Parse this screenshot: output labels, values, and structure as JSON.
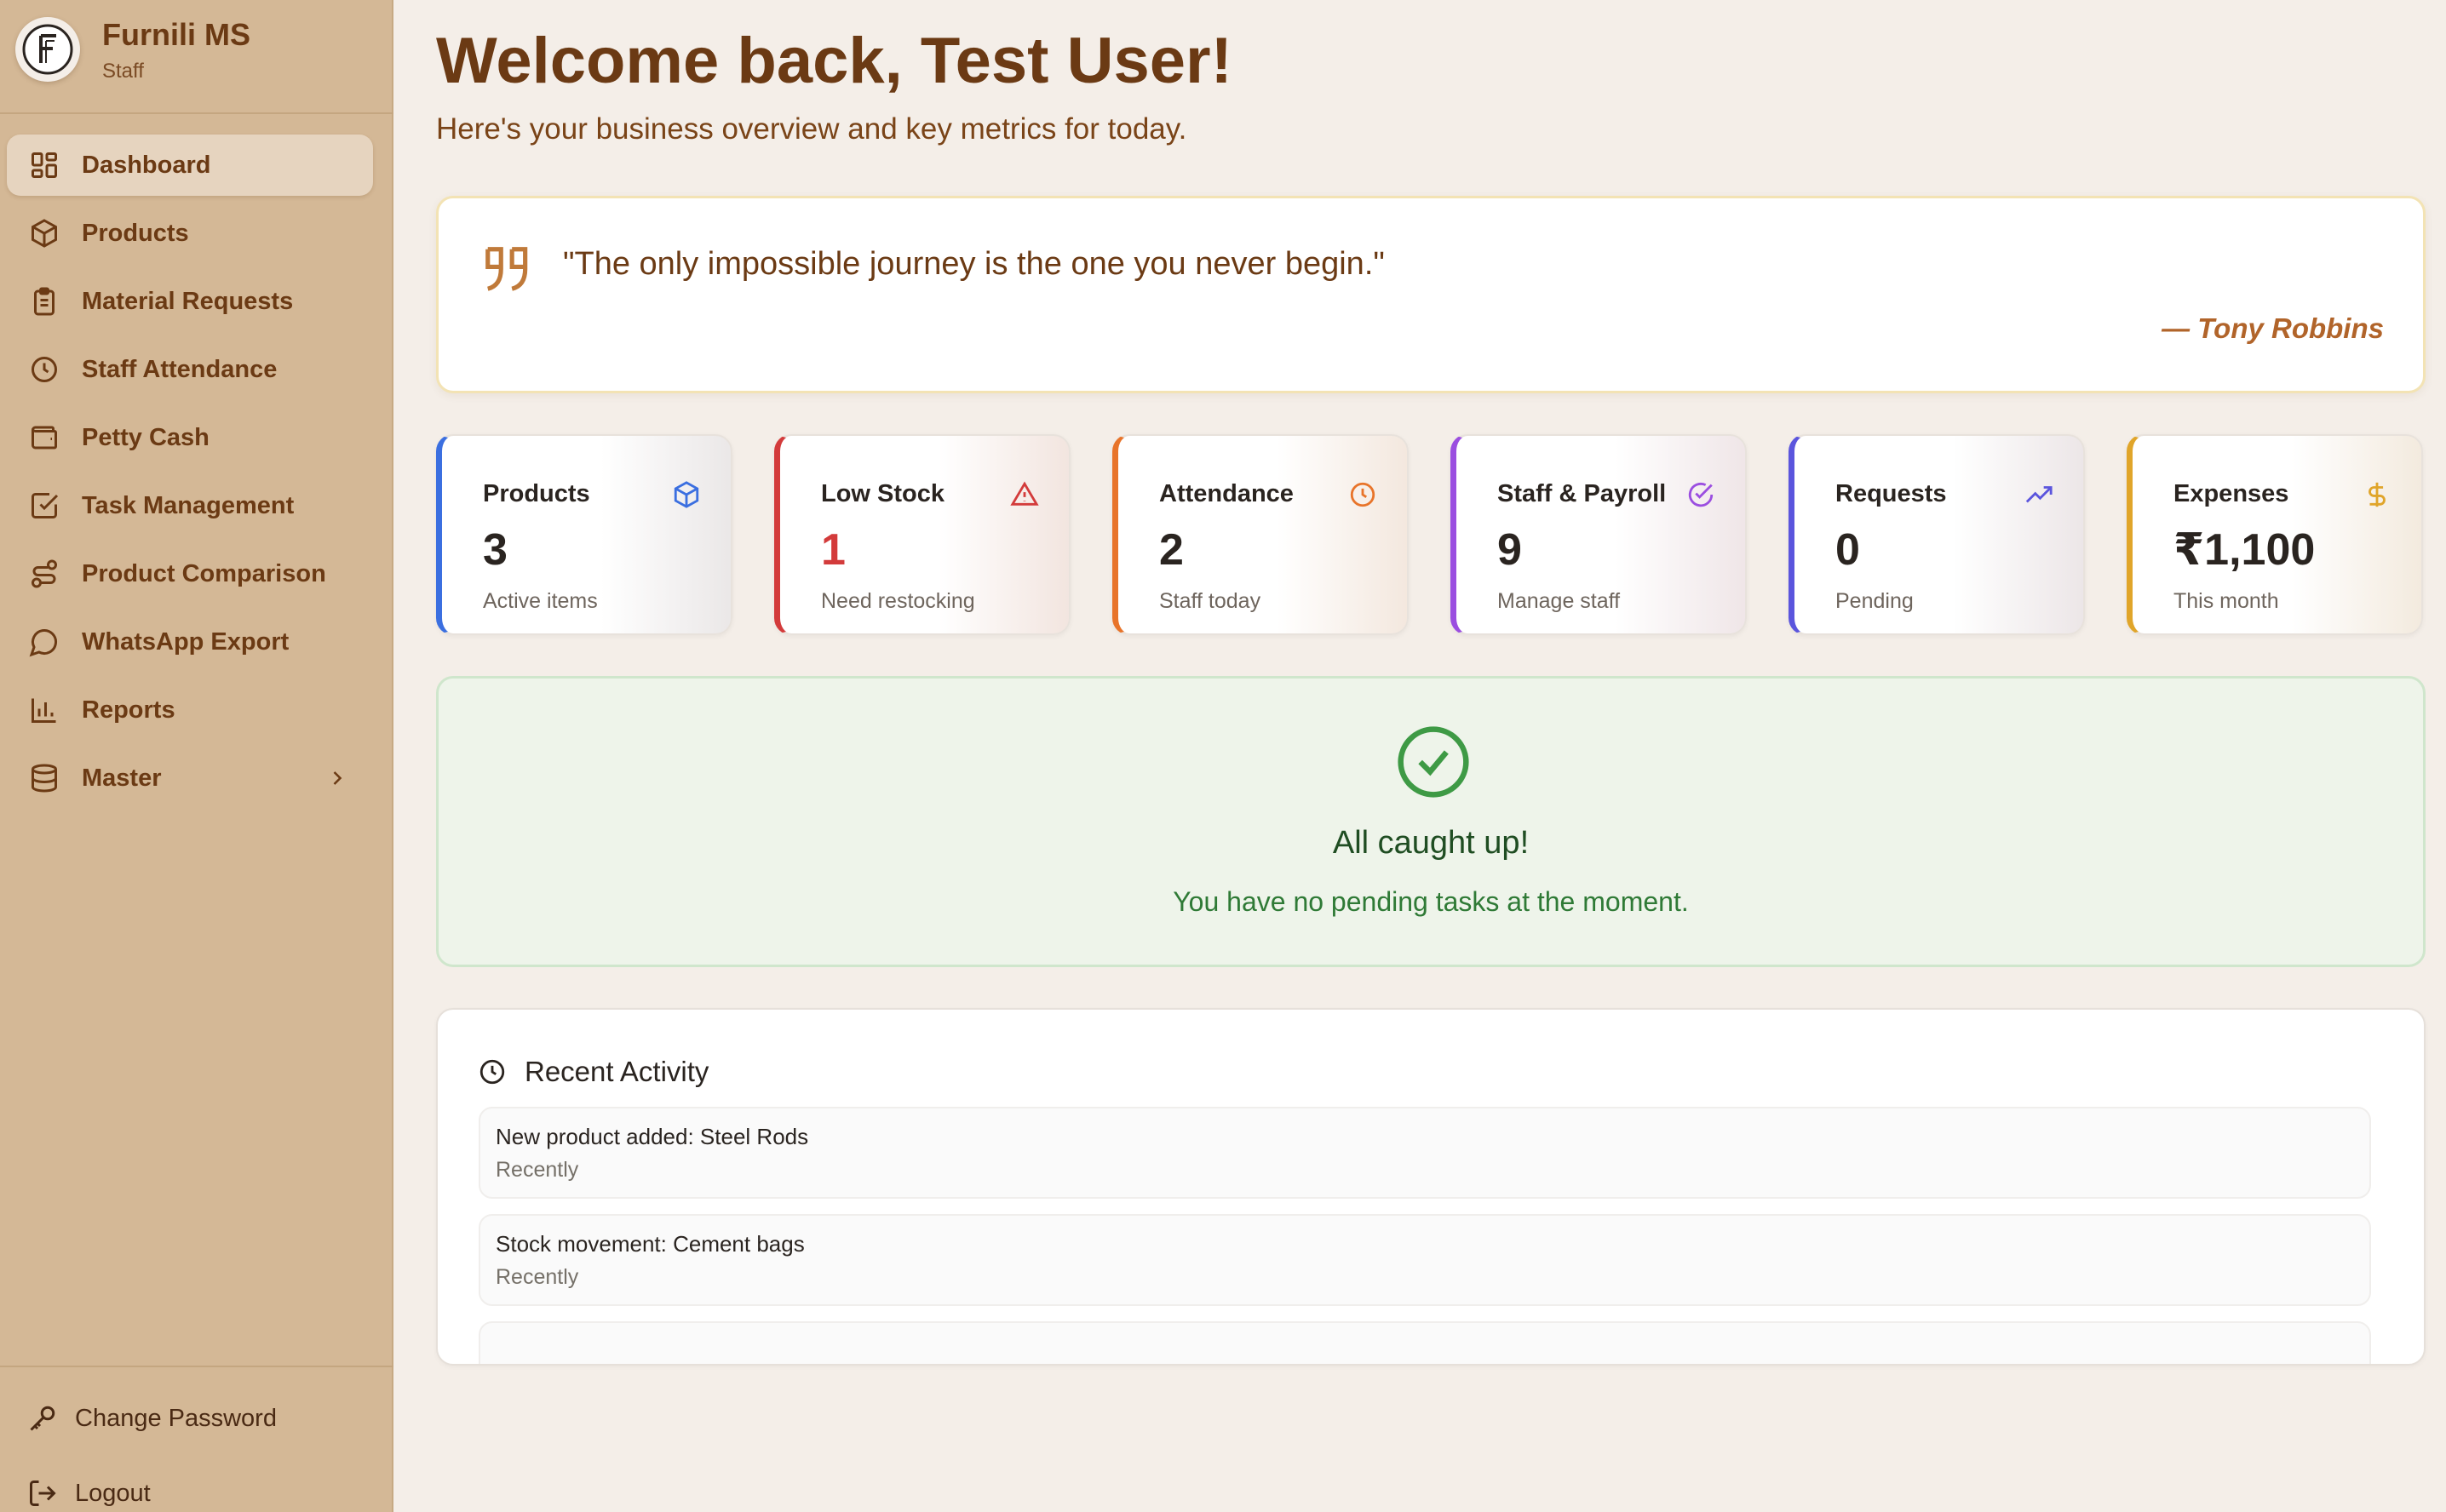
{
  "app": {
    "name": "Furnili MS",
    "role": "Staff",
    "logo_letter": "F"
  },
  "sidebar": {
    "items": [
      {
        "label": "Dashboard",
        "icon": "grid-icon",
        "active": true
      },
      {
        "label": "Products",
        "icon": "box-icon"
      },
      {
        "label": "Material Requests",
        "icon": "clipboard-icon"
      },
      {
        "label": "Staff Attendance",
        "icon": "clock-icon"
      },
      {
        "label": "Petty Cash",
        "icon": "wallet-icon"
      },
      {
        "label": "Task Management",
        "icon": "check-square-icon"
      },
      {
        "label": "Product Comparison",
        "icon": "route-icon"
      },
      {
        "label": "WhatsApp Export",
        "icon": "chat-bubble-icon"
      },
      {
        "label": "Reports",
        "icon": "bar-chart-icon"
      },
      {
        "label": "Master",
        "icon": "database-icon",
        "has_submenu": true
      }
    ],
    "bottom": {
      "change_password": "Change Password",
      "logout": "Logout"
    }
  },
  "header": {
    "welcome": "Welcome back, Test User!",
    "subtitle": "Here's your business overview and key metrics for today."
  },
  "quote": {
    "text": "\"The only impossible journey is the one you never begin.\"",
    "author": "— Tony Robbins"
  },
  "stats": [
    {
      "title": "Products",
      "value": "3",
      "label": "Active items",
      "accent": "#3b6fe0",
      "icon": "box-icon"
    },
    {
      "title": "Low Stock",
      "value": "1",
      "label": "Need restocking",
      "accent": "#d33b3b",
      "icon": "alert-triangle-icon",
      "value_color": "#d33b3b"
    },
    {
      "title": "Attendance",
      "value": "2",
      "label": "Staff today",
      "accent": "#e8742a",
      "icon": "clock-icon"
    },
    {
      "title": "Staff & Payroll",
      "value": "9",
      "label": "Manage staff",
      "accent": "#9b4ee0",
      "icon": "check-circle-icon"
    },
    {
      "title": "Requests",
      "value": "0",
      "label": "Pending",
      "accent": "#5b55dd",
      "icon": "trending-up-icon"
    },
    {
      "title": "Expenses",
      "value": "₹1,100",
      "label": "This month",
      "accent": "#e0a52a",
      "icon": "dollar-icon"
    }
  ],
  "caught_up": {
    "title": "All caught up!",
    "subtitle": "You have no pending tasks at the moment."
  },
  "recent_activity": {
    "title": "Recent Activity",
    "items": [
      {
        "text": "New product added: Steel Rods",
        "time": "Recently"
      },
      {
        "text": "Stock movement: Cement bags",
        "time": "Recently"
      }
    ]
  },
  "colors": {
    "sidebar_bg": "#d4b896",
    "page_bg": "#f4eee8",
    "brand_brown": "#6b3a14",
    "quote_accent": "#b1642a",
    "success_green": "#3e9a45"
  }
}
